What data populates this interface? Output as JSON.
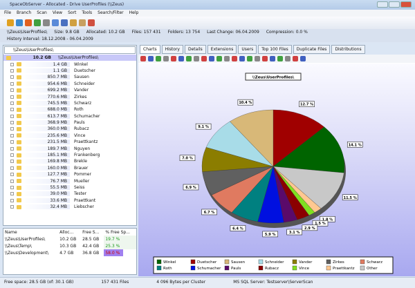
{
  "window": {
    "title": "SpaceObServer - Allocated - Drive UserProfiles (\\\\Zeus)"
  },
  "menu": [
    "File",
    "Branch",
    "Scan",
    "View",
    "Sort",
    "Tools",
    "Search/Filter",
    "Help"
  ],
  "info": {
    "path": "\\\\Zeus\\UserProfiles\\",
    "size": "Size: 9.8 GB",
    "allocated": "Allocated: 10.2 GB",
    "files": "Files: 157 431",
    "folders": "Folders: 13 754",
    "last_change": "Last Change: 06.04.2009",
    "compression": "Compression: 0.0 %"
  },
  "history": "History Interval: 18.12.2008 - 06.04.2009",
  "tree": {
    "combo": "\\\\Zeus\\UserProfiles\\",
    "root": {
      "size": "10.2 GB",
      "name": "\\\\Zeus\\UserProfiles\\"
    },
    "items": [
      [
        "1.4 GB",
        "Winkel"
      ],
      [
        "1.1 GB",
        "Duetscher"
      ],
      [
        "850.7 MB",
        "Sausen"
      ],
      [
        "954.6 MB",
        "Schneider"
      ],
      [
        "699.2 MB",
        "Vander"
      ],
      [
        "770.6 MB",
        "Zirkes"
      ],
      [
        "745.5 MB",
        "Schwarz"
      ],
      [
        "688.0 MB",
        "Roth"
      ],
      [
        "613.7 MB",
        "Schumacher"
      ],
      [
        "368.9 MB",
        "Pauls"
      ],
      [
        "360.0 MB",
        "Rubacz"
      ],
      [
        "235.6 MB",
        "Vince"
      ],
      [
        "231.5 MB",
        "Praettkantz"
      ],
      [
        "189.7 MB",
        "Nguyen"
      ],
      [
        "185.1 MB",
        "Frankenberg"
      ],
      [
        "169.8 MB",
        "Brekle"
      ],
      [
        "160.0 MB",
        "Brauer"
      ],
      [
        "127.7 MB",
        "Pommer"
      ],
      [
        "76.7 MB",
        "Mueller"
      ],
      [
        "55.5 MB",
        "Seiss"
      ],
      [
        "39.0 MB",
        "Tester"
      ],
      [
        "33.6 MB",
        "Praettkant"
      ],
      [
        "32.4 MB",
        "Liebscher"
      ]
    ]
  },
  "drives": {
    "headers": [
      "Name",
      "Alloc...",
      "Free S...",
      "% Free Sp..."
    ],
    "rows": [
      [
        "\\\\Zeus\\UserProfiles\\",
        "10.2 GB",
        "28.5 GB",
        "19.7 %"
      ],
      [
        "\\\\Zeus\\Temp\\",
        "10.3 GB",
        "42.4 GB",
        "25.3 %"
      ],
      [
        "\\\\Zeus\\Development\\",
        "4.7 GB",
        "36.8 GB",
        "58.0 %"
      ]
    ]
  },
  "status": {
    "free": "Free space: 28.5 GB (of: 30.1 GB)",
    "files": "157 431 Files",
    "cluster": "4 096 Bytes per Cluster",
    "db": "MS SQL Server: Testserver\\ServerScan"
  },
  "tabs": [
    "Charts",
    "History",
    "Details",
    "Extensions",
    "Users",
    "Top 100 Files",
    "Duplicate Files",
    "Distributions"
  ],
  "chart_data": {
    "type": "pie",
    "title": "\\\\Zeus\\UserProfiles\\",
    "slices": [
      {
        "name": "Duetscher",
        "value": 12.7,
        "color": "#a00000"
      },
      {
        "name": "Winkel",
        "value": 14.1,
        "color": "#006400"
      },
      {
        "name": "Other",
        "value": 11.5,
        "color": "#c8c8c8"
      },
      {
        "name": "Praettkantz",
        "value": 1.8,
        "color": "#ffc890"
      },
      {
        "name": "Vince",
        "value": 1.5,
        "color": "#80e020"
      },
      {
        "name": "Rubacz",
        "value": 2.9,
        "color": "#8b0000"
      },
      {
        "name": "Pauls",
        "value": 3.1,
        "color": "#5a0a6a"
      },
      {
        "name": "Schumacher",
        "value": 5.9,
        "color": "#0010e0"
      },
      {
        "name": "Roth",
        "value": 6.4,
        "color": "#008080"
      },
      {
        "name": "Schwarz",
        "value": 6.7,
        "color": "#e07a60"
      },
      {
        "name": "Zirkes",
        "value": 6.9,
        "color": "#606060"
      },
      {
        "name": "Vander",
        "value": 7.0,
        "color": "#8b7d00"
      },
      {
        "name": "Schneider",
        "value": 9.1,
        "color": "#a8dce8"
      },
      {
        "name": "Sausen",
        "value": 10.4,
        "color": "#d8b878"
      }
    ],
    "legend": [
      "Winkel",
      "Duetscher",
      "Sausen",
      "Schneider",
      "Vander",
      "Zirkes",
      "Schwarz",
      "Roth",
      "Schumacher",
      "Pauls",
      "Rubacz",
      "Vince",
      "Praettkantz",
      "Other"
    ],
    "legend_position": "bottom"
  }
}
